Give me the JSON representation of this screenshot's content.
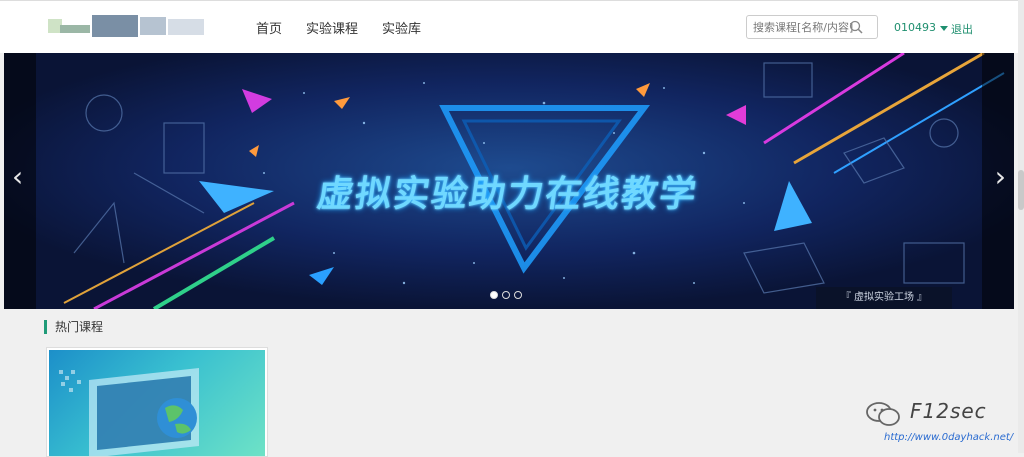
{
  "nav": {
    "items": [
      "首页",
      "实验课程",
      "实验库"
    ]
  },
  "search": {
    "placeholder": "搜索课程[名称/内容]"
  },
  "user": {
    "id": "010493",
    "logout": "退出"
  },
  "banner": {
    "headline": "虚拟实验助力在线教学",
    "tag": "『 虚拟实验工场 』",
    "slides": 3,
    "active_slide": 1
  },
  "section": {
    "title": "热门课程"
  },
  "watermark": {
    "name": "F12sec",
    "url": "http://www.0dayhack.net/"
  },
  "colors": {
    "accent": "#1f8f6f",
    "banner_bg": "#0b1538"
  }
}
